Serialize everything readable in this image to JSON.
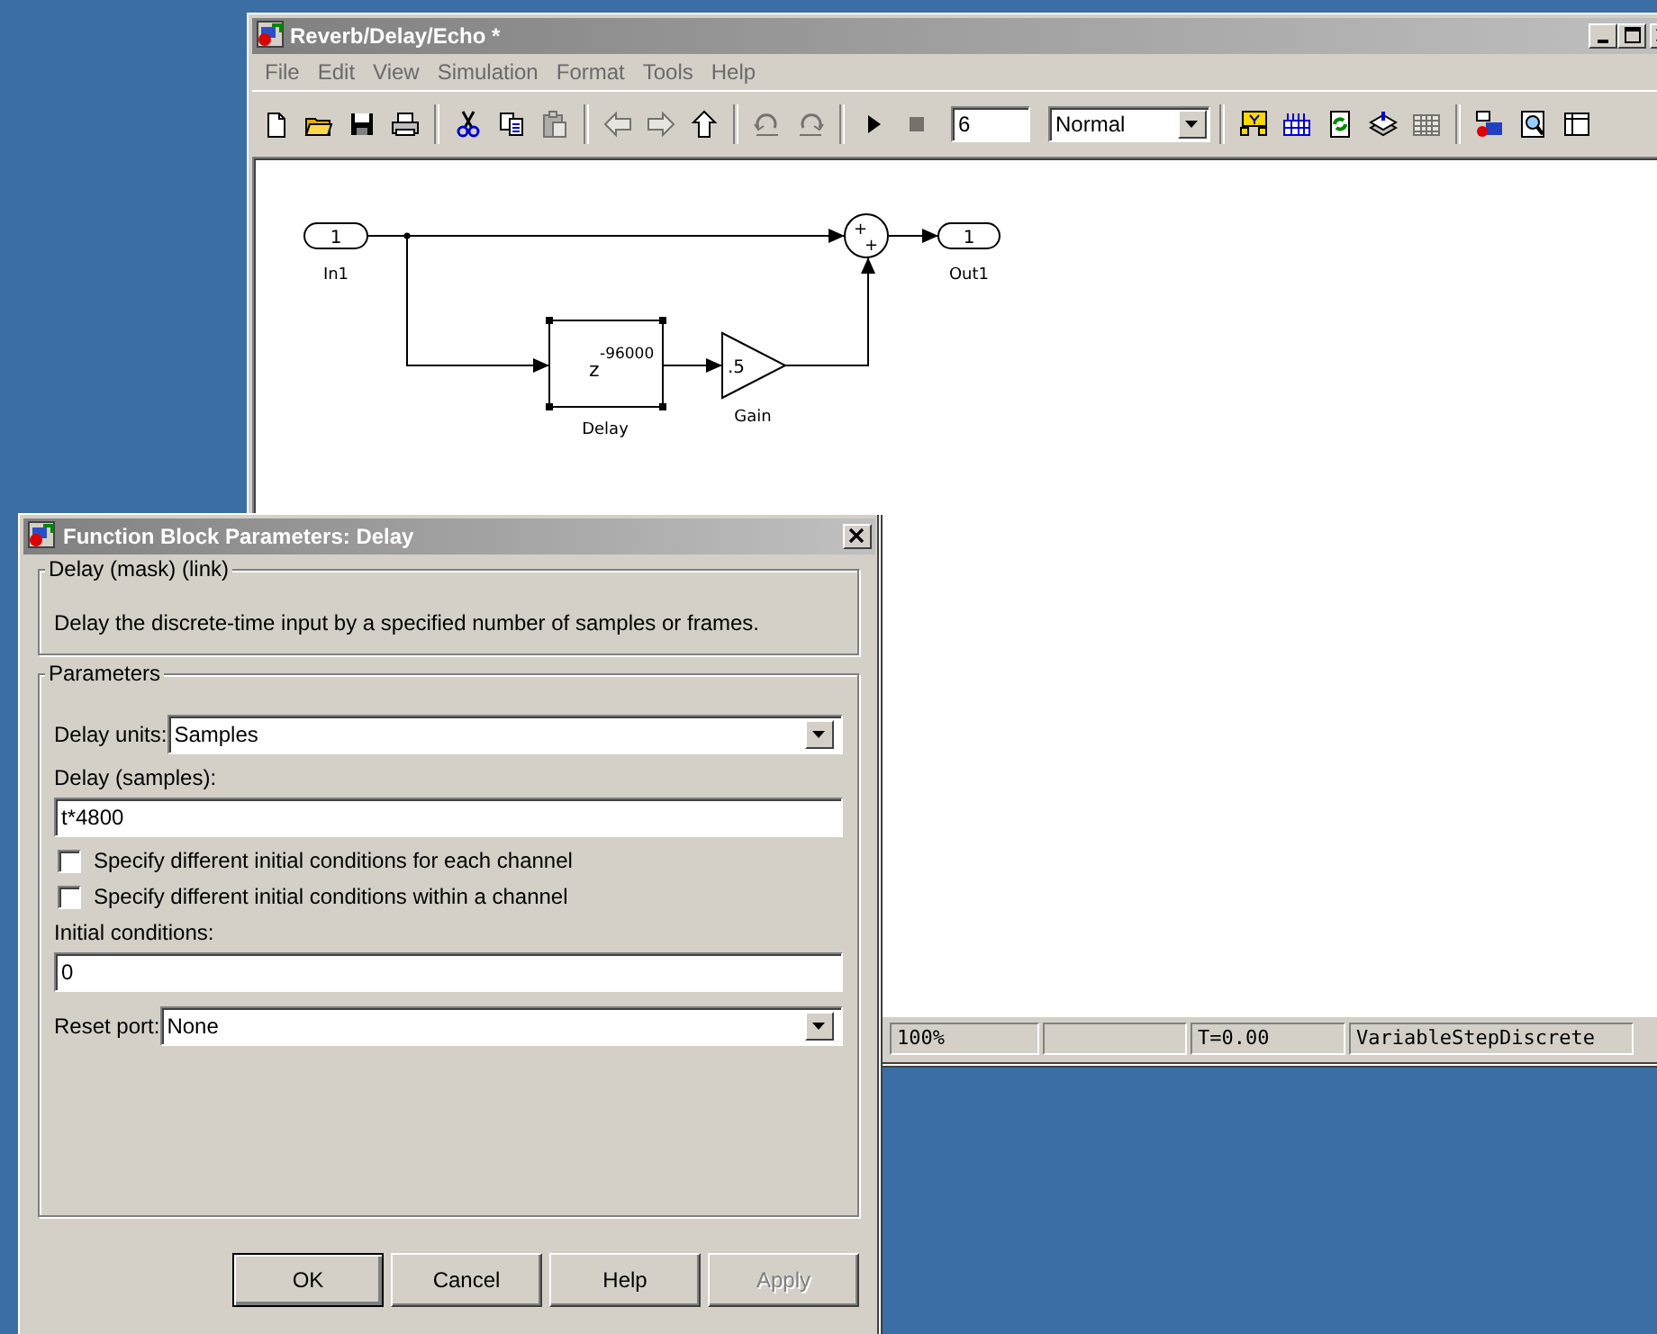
{
  "model_window": {
    "title": "Reverb/Delay/Echo *",
    "menu": [
      "File",
      "Edit",
      "View",
      "Simulation",
      "Format",
      "Tools",
      "Help"
    ],
    "toolbar": {
      "groups": [
        [
          {
            "disabled": false
          },
          {
            "disabled": false
          },
          {
            "disabled": false
          },
          {
            "disabled": false
          }
        ],
        [
          {
            "disabled": false
          },
          {
            "disabled": false
          },
          {
            "disabled": true
          }
        ],
        [
          {
            "disabled": true
          },
          {
            "disabled": true
          },
          {
            "disabled": false
          }
        ],
        [
          {
            "disabled": true
          },
          {
            "disabled": true
          }
        ],
        [
          {
            "disabled": false
          },
          {
            "disabled": true
          }
        ],
        [
          {
            "disabled": false
          },
          {
            "disabled": false
          },
          {
            "disabled": false
          },
          {
            "disabled": false
          },
          {
            "disabled": true
          }
        ],
        [
          {
            "disabled": false
          },
          {
            "disabled": false
          },
          {
            "disabled": false
          }
        ]
      ],
      "stop_time": "6",
      "mode": "Normal"
    },
    "diagram": {
      "inport": {
        "number": "1",
        "label": "In1"
      },
      "outport": {
        "number": "1",
        "label": "Out1"
      },
      "delay": {
        "symbol": "z",
        "exponent": "-96000",
        "label": "Delay",
        "selected": true
      },
      "gain": {
        "value": ".5",
        "label": "Gain"
      },
      "sum": {
        "signs": [
          "+",
          "+"
        ]
      }
    },
    "status_bar": [
      "100%",
      "T=0.00",
      "VariableStepDiscrete"
    ]
  },
  "dialog": {
    "title": "Function Block Parameters: Delay",
    "mask_group": {
      "label": "Delay (mask) (link)",
      "description": "Delay the discrete-time input by a specified number of samples or frames."
    },
    "parameters": {
      "label": "Parameters",
      "delay_units": {
        "label": "Delay units:",
        "value": "Samples"
      },
      "delay_samples": {
        "label": "Delay (samples):",
        "value": "t*4800"
      },
      "options": [
        {
          "label": "Specify different initial conditions for each channel",
          "checked": false
        },
        {
          "label": "Specify different initial conditions within a channel",
          "checked": false
        }
      ],
      "initial_conditions": {
        "label": "Initial conditions:",
        "value": "0"
      },
      "reset_port": {
        "label": "Reset port:",
        "value": "None"
      }
    },
    "buttons": [
      {
        "label": "OK",
        "disabled": false
      },
      {
        "label": "Cancel",
        "disabled": false
      },
      {
        "label": "Help",
        "disabled": false
      },
      {
        "label": "Apply",
        "disabled": true
      }
    ]
  }
}
